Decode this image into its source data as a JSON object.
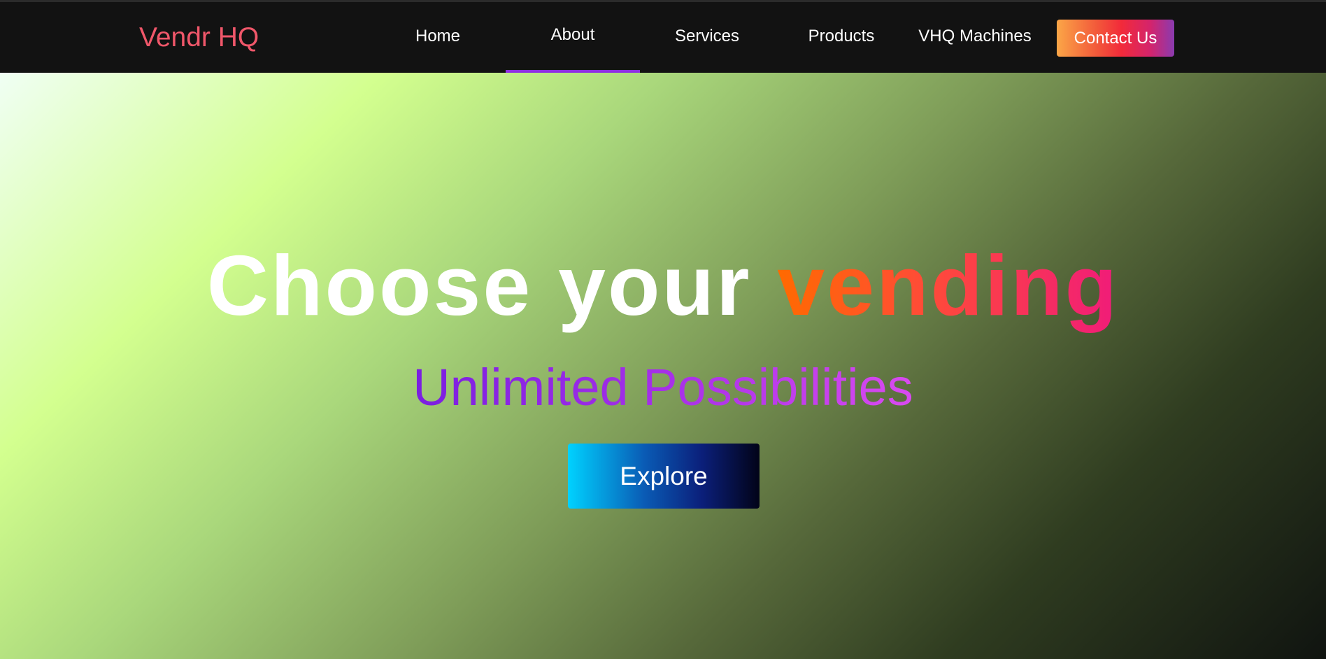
{
  "navbar": {
    "brand": "Vendr HQ",
    "items": [
      {
        "label": "Home",
        "active": false
      },
      {
        "label": "About",
        "active": true
      },
      {
        "label": "Services",
        "active": false
      },
      {
        "label": "Products",
        "active": false
      },
      {
        "label": "VHQ Machines",
        "active": false
      }
    ],
    "contact_label": "Contact Us"
  },
  "hero": {
    "headline_plain": "Choose your ",
    "headline_highlight": "vending",
    "subheadline": "Unlimited Possibilities",
    "cta_label": "Explore"
  },
  "colors": {
    "brand": "#f0576a",
    "active_indicator": "#8e2de2",
    "navbar_bg": "#121212"
  }
}
